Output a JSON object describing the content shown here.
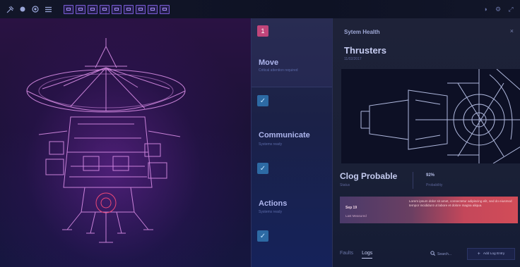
{
  "toolbar": {
    "left_icons": [
      "satellite-icon",
      "compass-icon",
      "globe-icon",
      "menu-icon"
    ],
    "tools": [
      "select-tool",
      "grid-tool",
      "image-tool",
      "pen-tool",
      "ruler-tool",
      "text-tool",
      "crop-tool",
      "align-tool",
      "layers-tool"
    ],
    "right_icons": [
      "contrast-icon",
      "settings-icon",
      "expand-icon"
    ]
  },
  "steps": [
    {
      "badge": "1",
      "title": "Move",
      "subtitle": "Critical attention required",
      "state": "active"
    },
    {
      "badge": "✓",
      "title": "Communicate",
      "subtitle": "Systems ready",
      "state": "done"
    },
    {
      "badge": "✓",
      "title": "Actions",
      "subtitle": "Systems ready",
      "state": "done"
    }
  ],
  "panel": {
    "title": "Sytem Health",
    "close": "×",
    "heading": "Thrusters",
    "date": "11/02/2017",
    "status": "Clog Probable",
    "status_label": "Status",
    "probability": "92%",
    "probability_label": "Probability",
    "alert": {
      "date": "Sep 19",
      "label": "Last Measured",
      "text": "Lorem ipsum dolor sit amet, consectetur adipiscing elit, sed do eiusmod tempor incididunt ut labore et dolore magna aliqua."
    },
    "tabs": [
      "Faults",
      "Logs"
    ],
    "active_tab": "Logs",
    "search_placeholder": "Search...",
    "add_button": "Add Log Entry"
  },
  "colors": {
    "badge_active": "#c0457a",
    "badge_done": "#2d6aa4",
    "alert_start": "#4a3a6a",
    "alert_end": "#d24c58",
    "wire": "#d98de6"
  }
}
